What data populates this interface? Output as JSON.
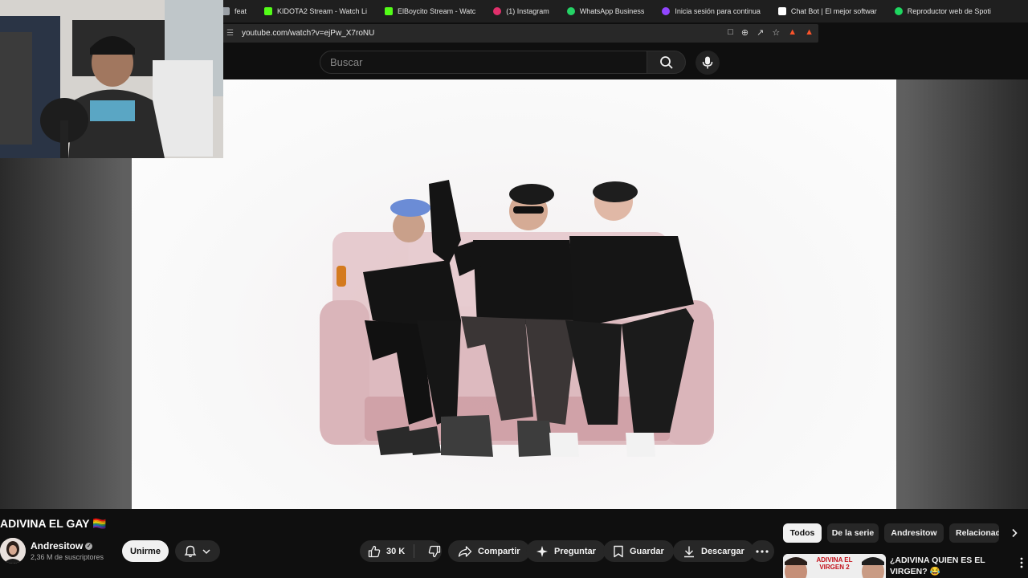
{
  "browser": {
    "bookmarks": [
      {
        "label": "feat",
        "icon": "generic-page-icon",
        "color": "#9aa0a6"
      },
      {
        "label": "KIDOTA2 Stream - Watch Li",
        "icon": "kick-icon",
        "color": "#53fc18"
      },
      {
        "label": "ElBoycito Stream - Watc",
        "icon": "kick-icon",
        "color": "#53fc18"
      },
      {
        "label": "(1) Instagram",
        "icon": "instagram-icon",
        "color": "#e1306c"
      },
      {
        "label": "WhatsApp Business",
        "icon": "whatsapp-icon",
        "color": "#25d366"
      },
      {
        "label": "Inicia sesión para continua",
        "icon": "twitch-icon",
        "color": "#9146ff"
      },
      {
        "label": "Chat Bot | El mejor softwar",
        "icon": "chatbot-icon",
        "color": "#ffffff"
      },
      {
        "label": "Reproductor web de Spoti",
        "icon": "spotify-icon",
        "color": "#1ed760"
      }
    ],
    "url": "youtube.com/watch?v=ejPw_X7roNU"
  },
  "search": {
    "placeholder": "Buscar"
  },
  "video": {
    "title": "ADIVINA EL GAY 🏳️‍🌈",
    "channel": "Andresitow",
    "subscribers": "2,36 M de suscriptores",
    "join_label": "Unirme",
    "likes": "30 K",
    "actions": {
      "share": "Compartir",
      "ask": "Preguntar",
      "save": "Guardar",
      "download": "Descargar"
    }
  },
  "sidebar": {
    "chips": [
      "Todos",
      "De la serie",
      "Andresitow",
      "Relacionados"
    ],
    "recommended": [
      {
        "title": "¿ADIVINA QUIEN ES EL VIRGEN? 😂",
        "thumb_text": "ADIVINA EL VIRGEN 2"
      }
    ]
  },
  "colors": {
    "background": "#0f0f0f",
    "chip_bg": "#272727",
    "chip_active_bg": "#f1f1f1",
    "kick_green": "#53fc18"
  }
}
